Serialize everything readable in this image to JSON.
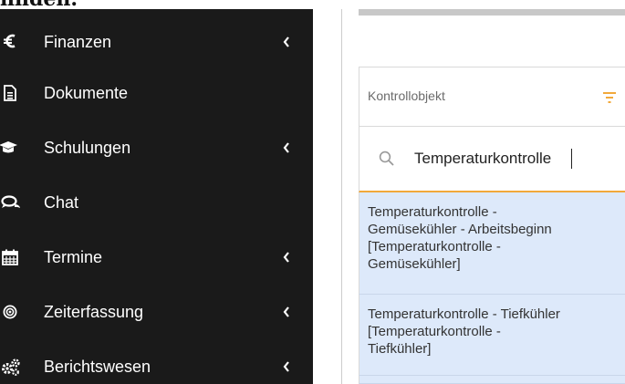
{
  "top_partial_text": "finden.",
  "sidebar": {
    "items": [
      {
        "label": "Finanzen",
        "icon": "euro-icon",
        "has_chevron": true
      },
      {
        "label": "Dokumente",
        "icon": "document-icon",
        "has_chevron": false
      },
      {
        "label": "Schulungen",
        "icon": "graduation-cap-icon",
        "has_chevron": true
      },
      {
        "label": "Chat",
        "icon": "chat-icon",
        "has_chevron": false
      },
      {
        "label": "Termine",
        "icon": "calendar-icon",
        "has_chevron": true
      },
      {
        "label": "Zeiterfassung",
        "icon": "target-icon",
        "has_chevron": true
      },
      {
        "label": "Berichtswesen",
        "icon": "cogs-icon",
        "has_chevron": true
      }
    ],
    "chevron": "‹"
  },
  "field": {
    "label": "Kontrollobjekt",
    "filter_icon": "filter-icon"
  },
  "search": {
    "value": "Temperaturkontrolle",
    "icon": "search-icon"
  },
  "options": [
    {
      "lines": [
        "Temperaturkontrolle -",
        "Gemüsekühler - Arbeitsbeginn",
        "[Temperaturkontrolle -",
        "Gemüsekühler]"
      ]
    },
    {
      "lines": [
        "Temperaturkontrolle - Tiefkühler",
        "[Temperaturkontrolle -",
        "Tiefkühler]"
      ]
    }
  ],
  "colors": {
    "sidebar_bg": "#1a1a1a",
    "accent_orange": "#f2a93b",
    "option_bg": "#dde9fa"
  }
}
